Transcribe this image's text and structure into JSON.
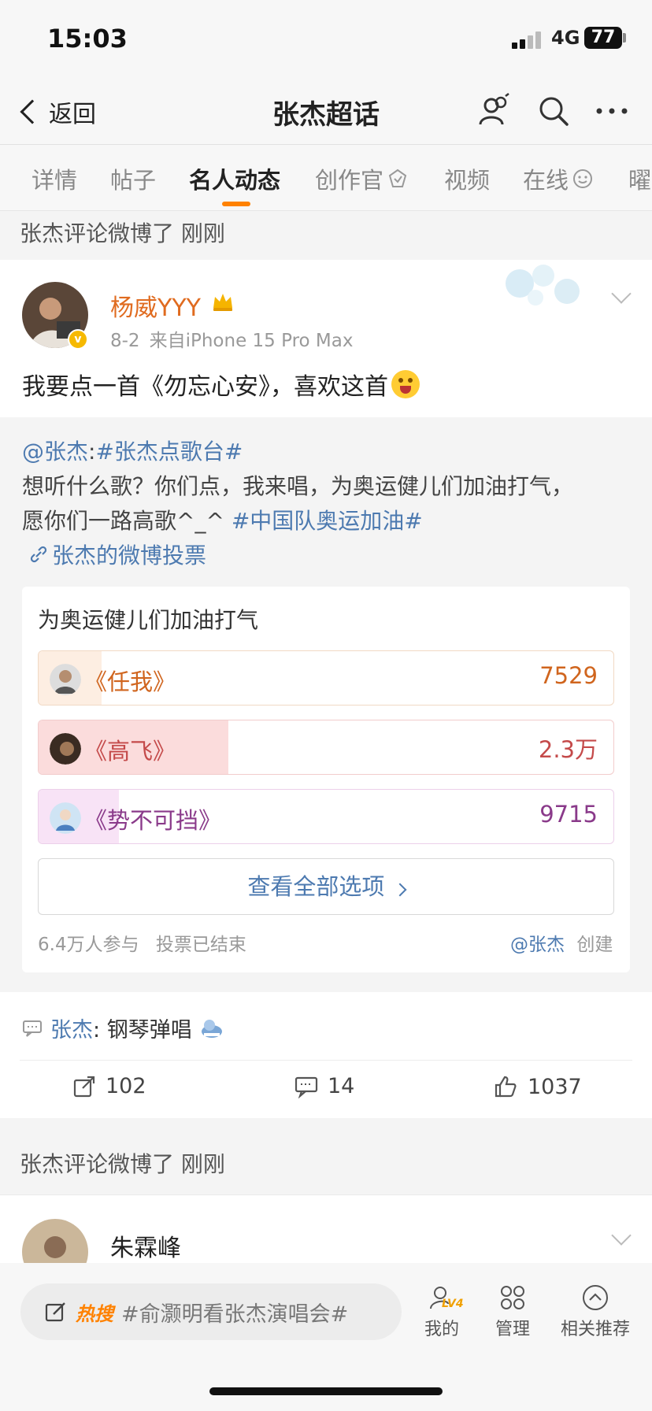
{
  "status": {
    "time": "15:03",
    "network": "4G",
    "battery": "77"
  },
  "nav": {
    "back_label": "返回",
    "title": "张杰超话"
  },
  "tabs": [
    {
      "label": "详情"
    },
    {
      "label": "帖子"
    },
    {
      "label": "名人动态"
    },
    {
      "label": "创作官"
    },
    {
      "label": "视频"
    },
    {
      "label": "在线"
    },
    {
      "label": "曜"
    }
  ],
  "feed": [
    {
      "header": "张杰评论微博了 刚刚"
    },
    {
      "header": "张杰评论微博了 刚刚"
    }
  ],
  "post": {
    "username": "杨威YYY",
    "date": "8-2",
    "source": "来自iPhone 15 Pro Max",
    "text": "我要点一首《勿忘心安》，喜欢这首"
  },
  "repost": {
    "mention": "@张杰",
    "colon": ":",
    "topic": "#张杰点歌台#",
    "line2": "想听什么歌？你们点，我来唱，为奥运健儿们加油打气，",
    "line3_text": "愿你们一路高歌^_^ ",
    "line3_topic": "#中国队奥运加油#",
    "link": "张杰的微博投票"
  },
  "vote": {
    "title": "为奥运健儿们加油打气",
    "options": [
      {
        "label": "《任我》",
        "count": "7529",
        "fraction": 0.11,
        "fill": "#fdeee2",
        "border": "#f1d9c4",
        "text": "#d0651e"
      },
      {
        "label": "《高飞》",
        "count": "2.3万",
        "fraction": 0.33,
        "fill": "#fbdcdc",
        "border": "#f2cccc",
        "text": "#c44a4a"
      },
      {
        "label": "《势不可挡》",
        "count": "9715",
        "fraction": 0.14,
        "fill": "#f8e3f6",
        "border": "#ecd0ea",
        "text": "#8a3a8a"
      }
    ],
    "see_all": "查看全部选项",
    "participants": "6.4万人参与",
    "status": "投票已结束",
    "creator": "@张杰",
    "created": "创建"
  },
  "comment": {
    "author": "张杰",
    "sep": ":",
    "text": "钢琴弹唱"
  },
  "actions": {
    "reposts": "102",
    "comments": "14",
    "likes": "1037"
  },
  "post2": {
    "username": "朱霖峰"
  },
  "bottom": {
    "hot_label": "热搜",
    "hot_topic": "#俞灏明看张杰演唱会#",
    "level": "LV4",
    "my": "我的",
    "manage": "管理",
    "related": "相关推荐"
  },
  "colors": {
    "accent": "#ff8200",
    "link": "#4d7ab0",
    "username": "#e06b1f"
  }
}
